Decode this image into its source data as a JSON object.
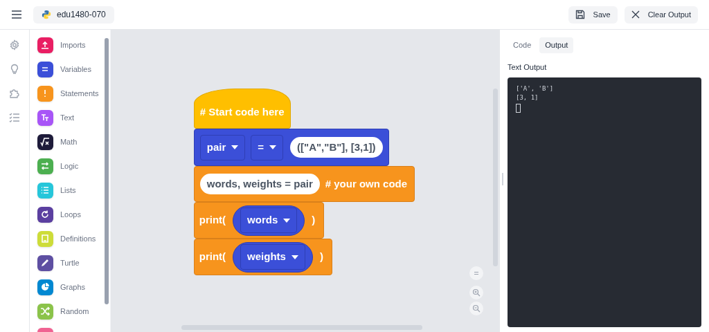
{
  "header": {
    "project": "edu1480-070",
    "buttons": [
      {
        "label": "Save",
        "kind": "save"
      },
      {
        "label": "Clear Output",
        "kind": "clear"
      }
    ]
  },
  "categories": [
    {
      "label": "Imports",
      "color": "#e91e63"
    },
    {
      "label": "Variables",
      "color": "#3b4fd8"
    },
    {
      "label": "Statements",
      "color": "#f7941d"
    },
    {
      "label": "Text",
      "color": "#a855f7"
    },
    {
      "label": "Math",
      "color": "#1e1b3a"
    },
    {
      "label": "Logic",
      "color": "#4caf50"
    },
    {
      "label": "Lists",
      "color": "#26c6da"
    },
    {
      "label": "Loops",
      "color": "#5b3fa0"
    },
    {
      "label": "Definitions",
      "color": "#cddc39"
    },
    {
      "label": "Turtle",
      "color": "#5e4fa2"
    },
    {
      "label": "Graphs",
      "color": "#0288d1"
    },
    {
      "label": "Random",
      "color": "#8bc34a"
    },
    {
      "color": "#f06292"
    }
  ],
  "blocks": [
    {
      "kind": "hat",
      "text": "# Start code here"
    },
    {
      "kind": "assign",
      "variable": "pair",
      "operator": "=",
      "value": "([\"A\",\"B\"], [3,1])"
    },
    {
      "kind": "code",
      "code": "words, weights = pair",
      "comment": "# your own code"
    },
    {
      "kind": "print",
      "prefix": "print(",
      "variable": "words",
      "suffix": ")"
    },
    {
      "kind": "print",
      "prefix": "print(",
      "variable": "weights",
      "suffix": ")"
    }
  ],
  "tabs": [
    {
      "label": "Code",
      "selected": false
    },
    {
      "label": "Output",
      "selected": true
    }
  ],
  "output": {
    "title": "Text Output",
    "lines": [
      "['A', 'B']",
      "[3, 1]"
    ]
  }
}
